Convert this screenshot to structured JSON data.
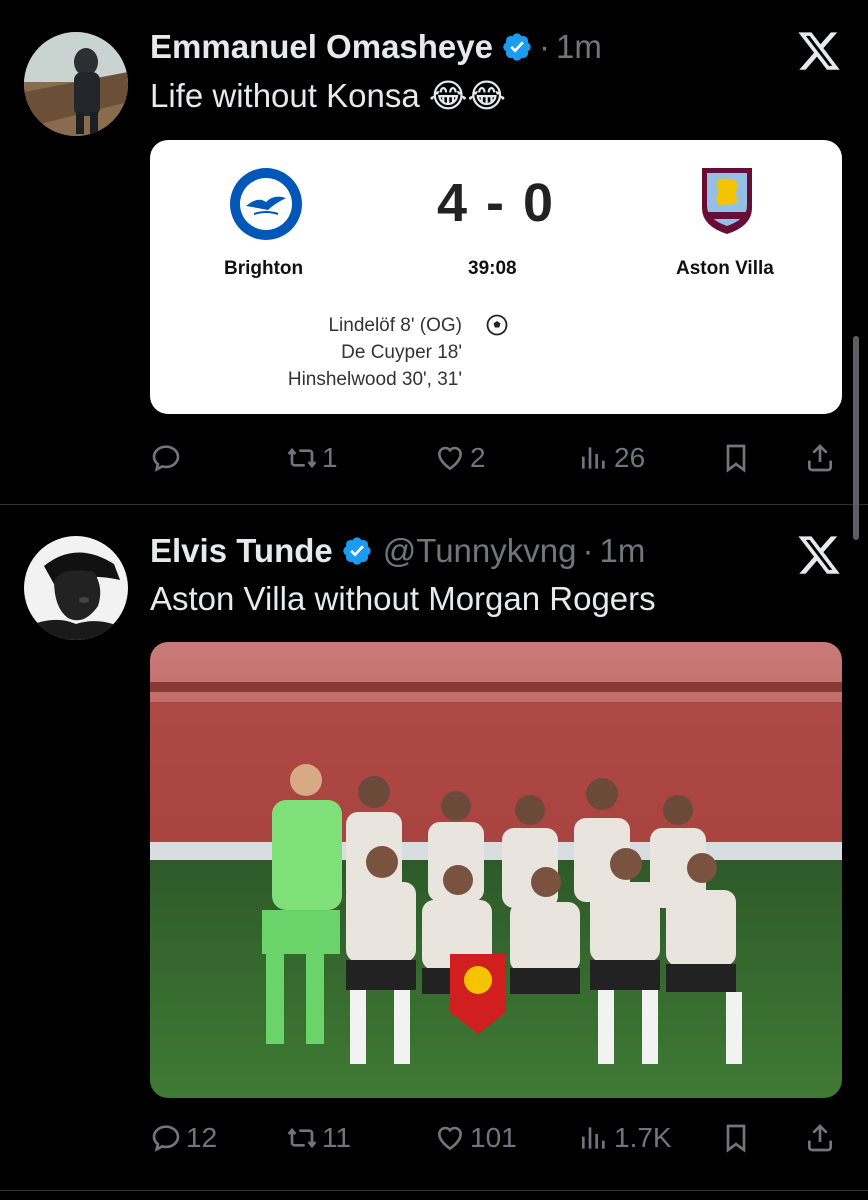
{
  "tweets": [
    {
      "author": "Emmanuel Omasheye",
      "time": "1m",
      "text": "Life without Konsa 😂😂",
      "card": {
        "home_team": "Brighton",
        "away_team": "Aston Villa",
        "score": "4 - 0",
        "clock": "39:08",
        "scorers": [
          "Lindelöf 8' (OG)",
          "De Cuyper 18'",
          "Hinshelwood 30', 31'"
        ]
      },
      "stats": {
        "replies": "",
        "reposts": "1",
        "likes": "2",
        "views": "26"
      }
    },
    {
      "author": "Elvis Tunde",
      "handle": "@Tunnykvng",
      "time": "1m",
      "text": "Aston Villa without Morgan Rogers",
      "stats": {
        "replies": "12",
        "reposts": "11",
        "likes": "101",
        "views": "1.7K"
      }
    }
  ],
  "colors": {
    "background": "#000000",
    "verified": "#1d9bf0",
    "muted": "#71767b",
    "brighton_blue": "#0057b8",
    "villa_claret": "#670e36"
  },
  "icons": [
    "x-logo-icon",
    "verified-badge-icon",
    "reply-icon",
    "repost-icon",
    "like-icon",
    "views-icon",
    "bookmark-icon",
    "share-icon",
    "football-icon"
  ]
}
